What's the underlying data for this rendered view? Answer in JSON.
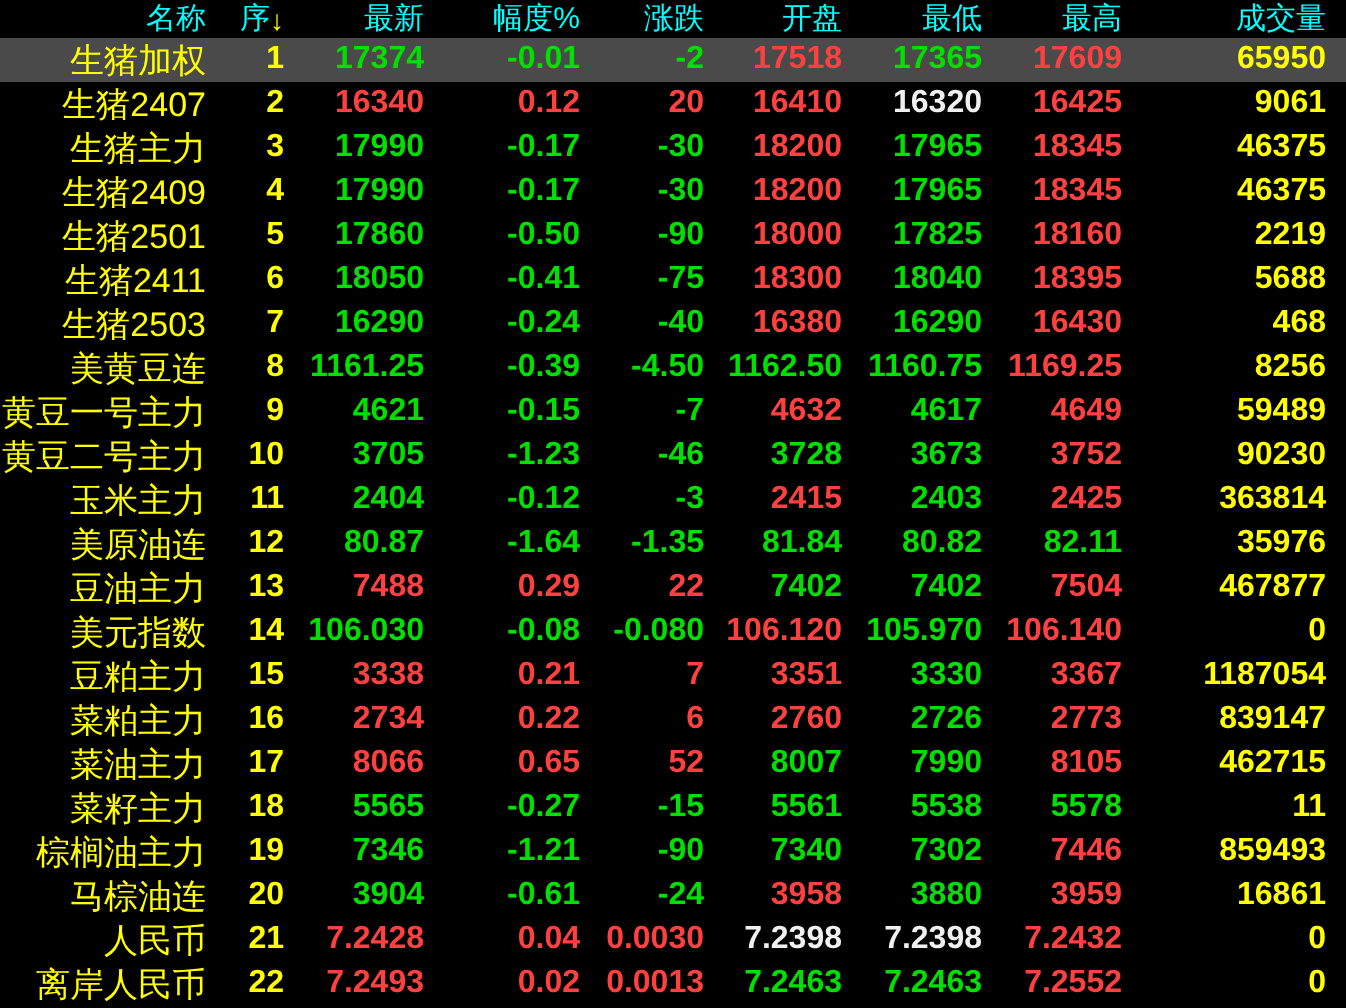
{
  "columns": [
    {
      "label": "名称"
    },
    {
      "label": "序",
      "sort_arrow": "↓"
    },
    {
      "label": "最新"
    },
    {
      "label": "幅度%"
    },
    {
      "label": "涨跌"
    },
    {
      "label": "开盘"
    },
    {
      "label": "最低"
    },
    {
      "label": "最高"
    },
    {
      "label": "成交量"
    }
  ],
  "rows": [
    {
      "name": "生猪加权",
      "index": "1",
      "selected": true,
      "cells": [
        {
          "value": "17374",
          "color": "#00e000"
        },
        {
          "value": "-0.01",
          "color": "#00e000"
        },
        {
          "value": "-2",
          "color": "#00e000"
        },
        {
          "value": "17518",
          "color": "#ff4040"
        },
        {
          "value": "17365",
          "color": "#00e000"
        },
        {
          "value": "17609",
          "color": "#ff4040"
        }
      ],
      "volume": "65950"
    },
    {
      "name": "生猪2407",
      "index": "2",
      "selected": false,
      "cells": [
        {
          "value": "16340",
          "color": "#ff4040"
        },
        {
          "value": "0.12",
          "color": "#ff4040"
        },
        {
          "value": "20",
          "color": "#ff4040"
        },
        {
          "value": "16410",
          "color": "#ff4040"
        },
        {
          "value": "16320",
          "color": "#f0f0f0"
        },
        {
          "value": "16425",
          "color": "#ff4040"
        }
      ],
      "volume": "9061"
    },
    {
      "name": "生猪主力",
      "index": "3",
      "selected": false,
      "cells": [
        {
          "value": "17990",
          "color": "#00e000"
        },
        {
          "value": "-0.17",
          "color": "#00e000"
        },
        {
          "value": "-30",
          "color": "#00e000"
        },
        {
          "value": "18200",
          "color": "#ff4040"
        },
        {
          "value": "17965",
          "color": "#00e000"
        },
        {
          "value": "18345",
          "color": "#ff4040"
        }
      ],
      "volume": "46375"
    },
    {
      "name": "生猪2409",
      "index": "4",
      "selected": false,
      "cells": [
        {
          "value": "17990",
          "color": "#00e000"
        },
        {
          "value": "-0.17",
          "color": "#00e000"
        },
        {
          "value": "-30",
          "color": "#00e000"
        },
        {
          "value": "18200",
          "color": "#ff4040"
        },
        {
          "value": "17965",
          "color": "#00e000"
        },
        {
          "value": "18345",
          "color": "#ff4040"
        }
      ],
      "volume": "46375"
    },
    {
      "name": "生猪2501",
      "index": "5",
      "selected": false,
      "cells": [
        {
          "value": "17860",
          "color": "#00e000"
        },
        {
          "value": "-0.50",
          "color": "#00e000"
        },
        {
          "value": "-90",
          "color": "#00e000"
        },
        {
          "value": "18000",
          "color": "#ff4040"
        },
        {
          "value": "17825",
          "color": "#00e000"
        },
        {
          "value": "18160",
          "color": "#ff4040"
        }
      ],
      "volume": "2219"
    },
    {
      "name": "生猪2411",
      "index": "6",
      "selected": false,
      "cells": [
        {
          "value": "18050",
          "color": "#00e000"
        },
        {
          "value": "-0.41",
          "color": "#00e000"
        },
        {
          "value": "-75",
          "color": "#00e000"
        },
        {
          "value": "18300",
          "color": "#ff4040"
        },
        {
          "value": "18040",
          "color": "#00e000"
        },
        {
          "value": "18395",
          "color": "#ff4040"
        }
      ],
      "volume": "5688"
    },
    {
      "name": "生猪2503",
      "index": "7",
      "selected": false,
      "cells": [
        {
          "value": "16290",
          "color": "#00e000"
        },
        {
          "value": "-0.24",
          "color": "#00e000"
        },
        {
          "value": "-40",
          "color": "#00e000"
        },
        {
          "value": "16380",
          "color": "#ff4040"
        },
        {
          "value": "16290",
          "color": "#00e000"
        },
        {
          "value": "16430",
          "color": "#ff4040"
        }
      ],
      "volume": "468"
    },
    {
      "name": "美黄豆连",
      "index": "8",
      "selected": false,
      "cells": [
        {
          "value": "1161.25",
          "color": "#00e000"
        },
        {
          "value": "-0.39",
          "color": "#00e000"
        },
        {
          "value": "-4.50",
          "color": "#00e000"
        },
        {
          "value": "1162.50",
          "color": "#00e000"
        },
        {
          "value": "1160.75",
          "color": "#00e000"
        },
        {
          "value": "1169.25",
          "color": "#ff4040"
        }
      ],
      "volume": "8256"
    },
    {
      "name": "黄豆一号主力",
      "index": "9",
      "selected": false,
      "cells": [
        {
          "value": "4621",
          "color": "#00e000"
        },
        {
          "value": "-0.15",
          "color": "#00e000"
        },
        {
          "value": "-7",
          "color": "#00e000"
        },
        {
          "value": "4632",
          "color": "#ff4040"
        },
        {
          "value": "4617",
          "color": "#00e000"
        },
        {
          "value": "4649",
          "color": "#ff4040"
        }
      ],
      "volume": "59489"
    },
    {
      "name": "黄豆二号主力",
      "index": "10",
      "selected": false,
      "cells": [
        {
          "value": "3705",
          "color": "#00e000"
        },
        {
          "value": "-1.23",
          "color": "#00e000"
        },
        {
          "value": "-46",
          "color": "#00e000"
        },
        {
          "value": "3728",
          "color": "#00e000"
        },
        {
          "value": "3673",
          "color": "#00e000"
        },
        {
          "value": "3752",
          "color": "#ff4040"
        }
      ],
      "volume": "90230"
    },
    {
      "name": "玉米主力",
      "index": "11",
      "selected": false,
      "cells": [
        {
          "value": "2404",
          "color": "#00e000"
        },
        {
          "value": "-0.12",
          "color": "#00e000"
        },
        {
          "value": "-3",
          "color": "#00e000"
        },
        {
          "value": "2415",
          "color": "#ff4040"
        },
        {
          "value": "2403",
          "color": "#00e000"
        },
        {
          "value": "2425",
          "color": "#ff4040"
        }
      ],
      "volume": "363814"
    },
    {
      "name": "美原油连",
      "index": "12",
      "selected": false,
      "cells": [
        {
          "value": "80.87",
          "color": "#00e000"
        },
        {
          "value": "-1.64",
          "color": "#00e000"
        },
        {
          "value": "-1.35",
          "color": "#00e000"
        },
        {
          "value": "81.84",
          "color": "#00e000"
        },
        {
          "value": "80.82",
          "color": "#00e000"
        },
        {
          "value": "82.11",
          "color": "#00e000"
        }
      ],
      "volume": "35976"
    },
    {
      "name": "豆油主力",
      "index": "13",
      "selected": false,
      "cells": [
        {
          "value": "7488",
          "color": "#ff4040"
        },
        {
          "value": "0.29",
          "color": "#ff4040"
        },
        {
          "value": "22",
          "color": "#ff4040"
        },
        {
          "value": "7402",
          "color": "#00e000"
        },
        {
          "value": "7402",
          "color": "#00e000"
        },
        {
          "value": "7504",
          "color": "#ff4040"
        }
      ],
      "volume": "467877"
    },
    {
      "name": "美元指数",
      "index": "14",
      "selected": false,
      "cells": [
        {
          "value": "106.030",
          "color": "#00e000"
        },
        {
          "value": "-0.08",
          "color": "#00e000"
        },
        {
          "value": "-0.080",
          "color": "#00e000"
        },
        {
          "value": "106.120",
          "color": "#ff4040"
        },
        {
          "value": "105.970",
          "color": "#00e000"
        },
        {
          "value": "106.140",
          "color": "#ff4040"
        }
      ],
      "volume": "0"
    },
    {
      "name": "豆粕主力",
      "index": "15",
      "selected": false,
      "cells": [
        {
          "value": "3338",
          "color": "#ff4040"
        },
        {
          "value": "0.21",
          "color": "#ff4040"
        },
        {
          "value": "7",
          "color": "#ff4040"
        },
        {
          "value": "3351",
          "color": "#ff4040"
        },
        {
          "value": "3330",
          "color": "#00e000"
        },
        {
          "value": "3367",
          "color": "#ff4040"
        }
      ],
      "volume": "1187054"
    },
    {
      "name": "菜粕主力",
      "index": "16",
      "selected": false,
      "cells": [
        {
          "value": "2734",
          "color": "#ff4040"
        },
        {
          "value": "0.22",
          "color": "#ff4040"
        },
        {
          "value": "6",
          "color": "#ff4040"
        },
        {
          "value": "2760",
          "color": "#ff4040"
        },
        {
          "value": "2726",
          "color": "#00e000"
        },
        {
          "value": "2773",
          "color": "#ff4040"
        }
      ],
      "volume": "839147"
    },
    {
      "name": "菜油主力",
      "index": "17",
      "selected": false,
      "cells": [
        {
          "value": "8066",
          "color": "#ff4040"
        },
        {
          "value": "0.65",
          "color": "#ff4040"
        },
        {
          "value": "52",
          "color": "#ff4040"
        },
        {
          "value": "8007",
          "color": "#00e000"
        },
        {
          "value": "7990",
          "color": "#00e000"
        },
        {
          "value": "8105",
          "color": "#ff4040"
        }
      ],
      "volume": "462715"
    },
    {
      "name": "菜籽主力",
      "index": "18",
      "selected": false,
      "cells": [
        {
          "value": "5565",
          "color": "#00e000"
        },
        {
          "value": "-0.27",
          "color": "#00e000"
        },
        {
          "value": "-15",
          "color": "#00e000"
        },
        {
          "value": "5561",
          "color": "#00e000"
        },
        {
          "value": "5538",
          "color": "#00e000"
        },
        {
          "value": "5578",
          "color": "#00e000"
        }
      ],
      "volume": "11"
    },
    {
      "name": "棕榈油主力",
      "index": "19",
      "selected": false,
      "cells": [
        {
          "value": "7346",
          "color": "#00e000"
        },
        {
          "value": "-1.21",
          "color": "#00e000"
        },
        {
          "value": "-90",
          "color": "#00e000"
        },
        {
          "value": "7340",
          "color": "#00e000"
        },
        {
          "value": "7302",
          "color": "#00e000"
        },
        {
          "value": "7446",
          "color": "#ff4040"
        }
      ],
      "volume": "859493"
    },
    {
      "name": "马棕油连",
      "index": "20",
      "selected": false,
      "cells": [
        {
          "value": "3904",
          "color": "#00e000"
        },
        {
          "value": "-0.61",
          "color": "#00e000"
        },
        {
          "value": "-24",
          "color": "#00e000"
        },
        {
          "value": "3958",
          "color": "#ff4040"
        },
        {
          "value": "3880",
          "color": "#00e000"
        },
        {
          "value": "3959",
          "color": "#ff4040"
        }
      ],
      "volume": "16861"
    },
    {
      "name": "人民币",
      "index": "21",
      "selected": false,
      "cells": [
        {
          "value": "7.2428",
          "color": "#ff4040"
        },
        {
          "value": "0.04",
          "color": "#ff4040"
        },
        {
          "value": "0.0030",
          "color": "#ff4040"
        },
        {
          "value": "7.2398",
          "color": "#f0f0f0"
        },
        {
          "value": "7.2398",
          "color": "#f0f0f0"
        },
        {
          "value": "7.2432",
          "color": "#ff4040"
        }
      ],
      "volume": "0"
    },
    {
      "name": "离岸人民币",
      "index": "22",
      "selected": false,
      "cells": [
        {
          "value": "7.2493",
          "color": "#ff4040"
        },
        {
          "value": "0.02",
          "color": "#ff4040"
        },
        {
          "value": "0.0013",
          "color": "#ff4040"
        },
        {
          "value": "7.2463",
          "color": "#00e000"
        },
        {
          "value": "7.2463",
          "color": "#00e000"
        },
        {
          "value": "7.2552",
          "color": "#ff4040"
        }
      ],
      "volume": "0"
    }
  ]
}
